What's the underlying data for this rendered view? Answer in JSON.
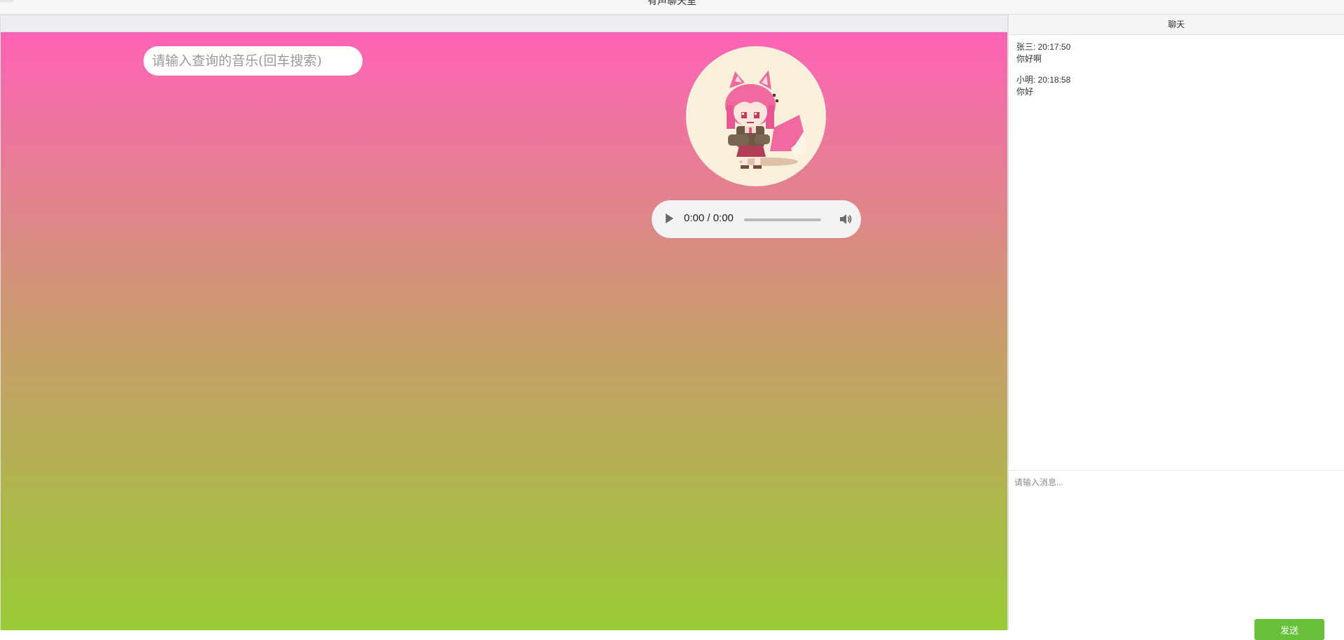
{
  "window": {
    "title": "有声聊天室"
  },
  "music": {
    "search_placeholder": "请输入查询的音乐(回车搜索)",
    "avatar_icon": "fox-girl-pixel-art",
    "player": {
      "time": "0:00 / 0:00",
      "progress": 0,
      "play_icon": "play-icon",
      "volume_icon": "volume-icon"
    },
    "gradient": [
      "#ff63b6",
      "#99cb33"
    ]
  },
  "chat": {
    "title": "聊天",
    "messages": [
      {
        "meta": "张三: 20:17:50",
        "text": "你好啊"
      },
      {
        "meta": "小明: 20:18:58",
        "text": "你好"
      }
    ],
    "input_placeholder": "请输入消息...",
    "send_label": "发送",
    "accent": "#67c23a"
  }
}
